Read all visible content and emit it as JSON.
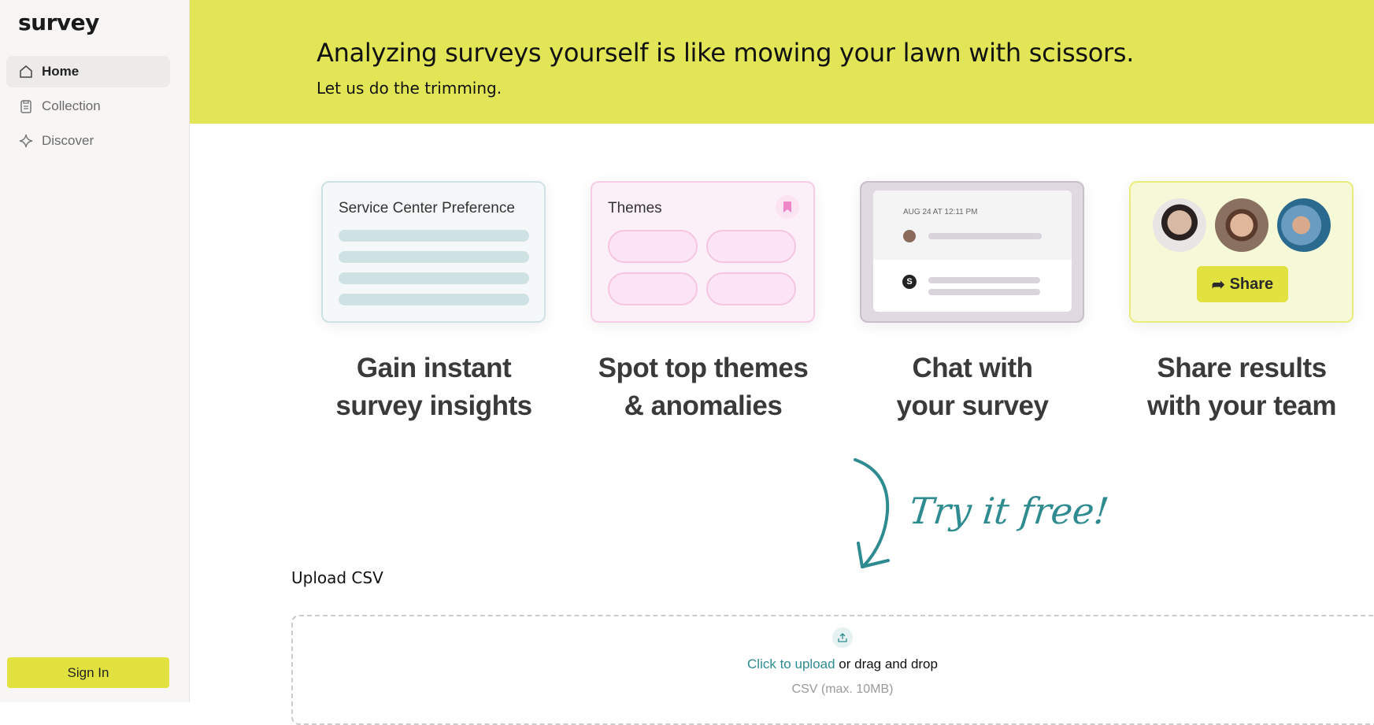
{
  "app": {
    "logo": "survey"
  },
  "sidebar": {
    "items": [
      {
        "label": "Home",
        "icon": "home-icon",
        "active": true
      },
      {
        "label": "Collection",
        "icon": "clipboard-icon"
      },
      {
        "label": "Discover",
        "icon": "sparkle-icon"
      }
    ],
    "sign_in": "Sign In"
  },
  "banner": {
    "title": "Analyzing surveys yourself is like mowing your lawn with scissors.",
    "subtitle": "Let us do the trimming."
  },
  "features": [
    {
      "card_title": "Service Center Preference",
      "heading1": "Gain instant",
      "heading2": "survey insights"
    },
    {
      "card_title": "Themes",
      "heading1": "Spot top themes",
      "heading2": "& anomalies"
    },
    {
      "card_date": "AUG 24 AT 12:11 PM",
      "avatar_letter": "S",
      "heading1": "Chat with",
      "heading2": "your survey"
    },
    {
      "button": "Share",
      "heading1": "Share results",
      "heading2": "with your team"
    }
  ],
  "cta": "Try it free!",
  "upload": {
    "label": "Upload CSV",
    "link": "Click to upload",
    "rest": " or drag and drop",
    "hint": "CSV (max. 10MB)"
  },
  "colors": {
    "accent": "#e1e556",
    "teal": "#2e8b8f",
    "button": "#e1e23f"
  }
}
